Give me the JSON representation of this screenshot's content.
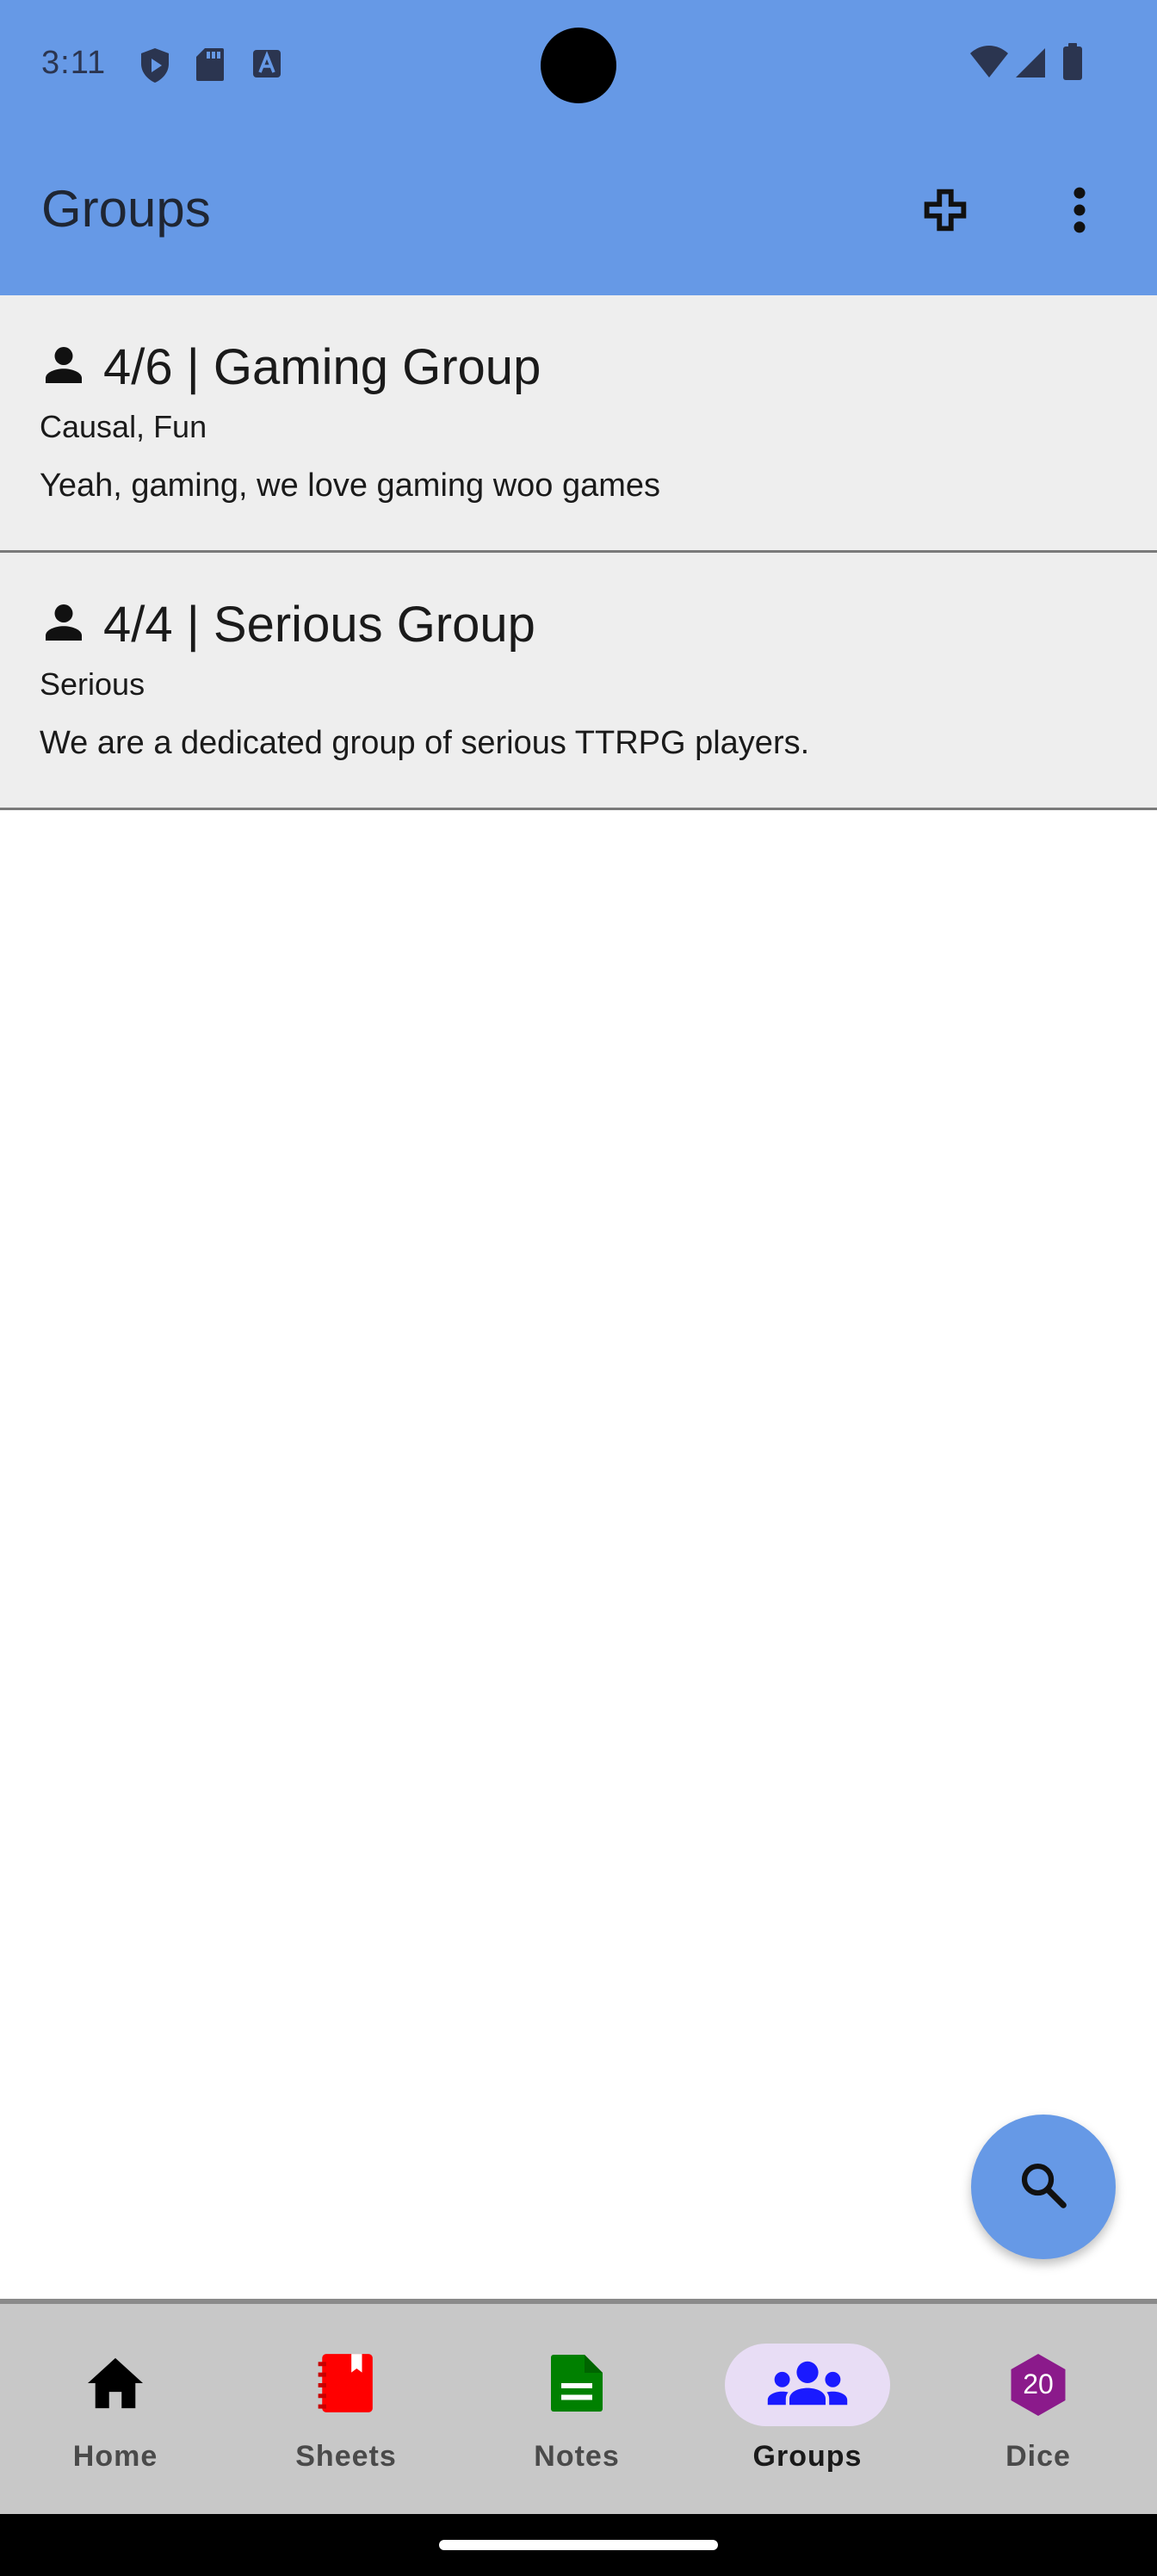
{
  "status_bar": {
    "time": "3:11",
    "icons": [
      "shield-play-icon",
      "sd-card-icon",
      "font-a-icon",
      "wifi-icon",
      "signal-icon",
      "battery-icon"
    ]
  },
  "app_bar": {
    "title": "Groups",
    "actions": [
      "add-icon",
      "more-vert-icon"
    ]
  },
  "groups": [
    {
      "title": "4/6 | Gaming Group",
      "tags": "Causal, Fun",
      "description": "Yeah, gaming, we love gaming woo games"
    },
    {
      "title": "4/4 | Serious Group",
      "tags": "Serious",
      "description": "We are a dedicated group of serious TTRPG players."
    }
  ],
  "fab": {
    "icon": "search-icon"
  },
  "bottom_nav": {
    "items": [
      {
        "label": "Home",
        "icon": "home-icon",
        "color": "#000000"
      },
      {
        "label": "Sheets",
        "icon": "sheets-icon",
        "color": "#ff0000"
      },
      {
        "label": "Notes",
        "icon": "notes-icon",
        "color": "#008000"
      },
      {
        "label": "Groups",
        "icon": "groups-icon",
        "color": "#1a1aff",
        "active": true
      },
      {
        "label": "Dice",
        "icon": "d20-icon",
        "color": "#8b1a8b",
        "badge": "20"
      }
    ]
  },
  "colors": {
    "primary": "#6699e6",
    "card_bg": "#eeeeee",
    "nav_bg": "#c8c8c8",
    "active_pill": "#e8ddf5"
  }
}
